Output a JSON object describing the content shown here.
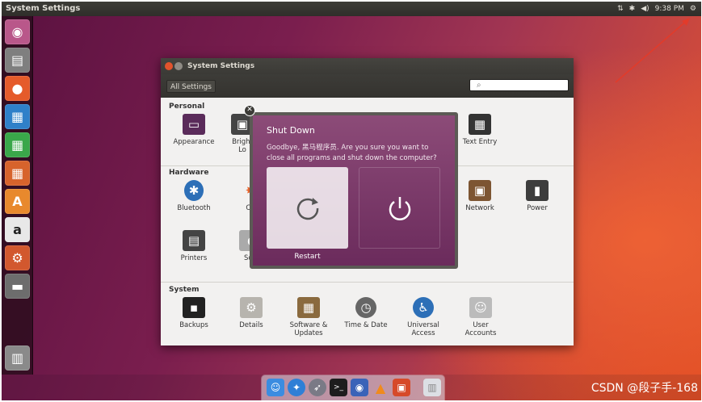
{
  "top_panel": {
    "title": "System Settings",
    "time": "9:38 PM",
    "network_icon": "network-icon",
    "bluetooth_icon": "bluetooth-icon",
    "volume_icon": "volume-icon",
    "gear_icon": "gear-icon"
  },
  "launcher": {
    "items": [
      {
        "name": "ubuntu-dash-icon",
        "color": "#b9578a"
      },
      {
        "name": "files-icon",
        "color": "#7f7f7f"
      },
      {
        "name": "firefox-icon",
        "color": "#e55b2b"
      },
      {
        "name": "writer-icon",
        "color": "#2f80c9"
      },
      {
        "name": "calc-icon",
        "color": "#3aa74a"
      },
      {
        "name": "impress-icon",
        "color": "#d7632c"
      },
      {
        "name": "software-center-icon",
        "color": "#e8892d"
      },
      {
        "name": "amazon-icon",
        "color": "#e8e8e8"
      },
      {
        "name": "system-settings-icon",
        "color": "#d2582e"
      },
      {
        "name": "disk-icon",
        "color": "#6d6d6d"
      },
      {
        "name": "trash-icon",
        "color": "#8a8a8a"
      }
    ]
  },
  "window": {
    "title": "System Settings",
    "all_settings": "All Settings",
    "sections": {
      "personal": "Personal",
      "hardware": "Hardware",
      "system": "System"
    },
    "personal_items": [
      "Appearance",
      "Bright",
      "Text Entry"
    ],
    "personal_items_second_line": [
      "",
      "Lo",
      ""
    ],
    "hardware_items": [
      "Bluetooth",
      "Co",
      "Network",
      "Power"
    ],
    "hardware_row2": [
      "Printers",
      "Sou"
    ],
    "system_items": [
      "Backups",
      "Details",
      "Software &",
      "Time & Date",
      "Universal",
      "User"
    ],
    "system_items_second_line": [
      "",
      "",
      "Updates",
      "",
      "Access",
      "Accounts"
    ]
  },
  "dialog": {
    "title": "Shut Down",
    "message": "Goodbye, 黑马程序员. Are you sure you want to close all programs and shut down the computer?",
    "restart_label": "Restart"
  },
  "dock": {
    "items": [
      "finder-icon",
      "safari-icon",
      "launchpad-icon",
      "terminal-icon",
      "app-icon",
      "vlc-icon",
      "vm-icon",
      "trash-icon"
    ]
  },
  "watermark": "CSDN @段子手-168"
}
